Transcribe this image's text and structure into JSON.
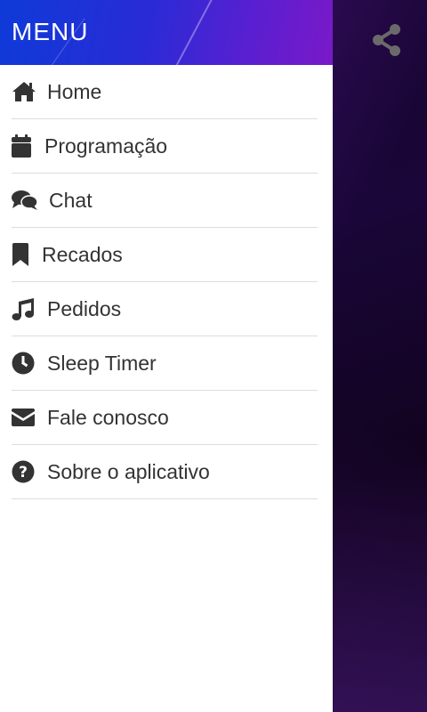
{
  "header": {
    "title": "MENU"
  },
  "share": {
    "icon": "share-icon"
  },
  "menu": {
    "items": [
      {
        "label": "Home",
        "icon": "home-icon"
      },
      {
        "label": "Programação",
        "icon": "calendar-icon"
      },
      {
        "label": "Chat",
        "icon": "chat-icon"
      },
      {
        "label": "Recados",
        "icon": "bookmark-icon"
      },
      {
        "label": "Pedidos",
        "icon": "music-note-icon"
      },
      {
        "label": "Sleep Timer",
        "icon": "clock-icon"
      },
      {
        "label": "Fale conosco",
        "icon": "envelope-icon"
      },
      {
        "label": "Sobre o aplicativo",
        "icon": "question-circle-icon"
      }
    ]
  },
  "colors": {
    "header_gradient_start": "#0e3ad8",
    "header_gradient_end": "#7a19c8",
    "background": "#14052a",
    "text": "#333333",
    "divider": "#dddddd"
  }
}
